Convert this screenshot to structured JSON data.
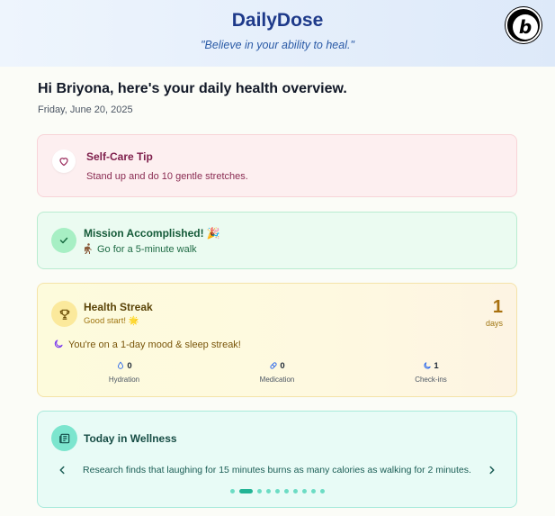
{
  "header": {
    "brand": "DailyDose",
    "tagline": "\"Believe in your ability to heal.\""
  },
  "greeting": "Hi Briyona, here's your daily health overview.",
  "date": "Friday, June 20, 2025",
  "self_care": {
    "title": "Self-Care Tip",
    "text": "Stand up and do 10 gentle stretches.",
    "icon": "heart-icon"
  },
  "mission": {
    "title": "Mission Accomplished! 🎉",
    "item": "Go for a 5-minute walk",
    "icon": "check-icon"
  },
  "streak": {
    "title": "Health Streak",
    "subtitle": "Good start! 🌟",
    "count": "1",
    "unit": "days",
    "message": "You're on a 1-day mood & sleep streak!",
    "stats": [
      {
        "value": "0",
        "label": "Hydration",
        "icon": "droplet-icon"
      },
      {
        "value": "0",
        "label": "Medication",
        "icon": "pill-icon"
      },
      {
        "value": "1",
        "label": "Check-ins",
        "icon": "moon-icon"
      }
    ]
  },
  "wellness": {
    "title": "Today in Wellness",
    "fact": "Research finds that laughing for 15 minutes burns as many calories as walking for 2 minutes.",
    "slides_total": 10,
    "active_slide": 2
  },
  "colors": {
    "brand": "#1e3a8a",
    "tip_bg": "#fdeff0",
    "mission_bg": "#ebfbf1",
    "streak_bg": "#fdfbdc",
    "wellness_bg": "#e8fbf6"
  }
}
